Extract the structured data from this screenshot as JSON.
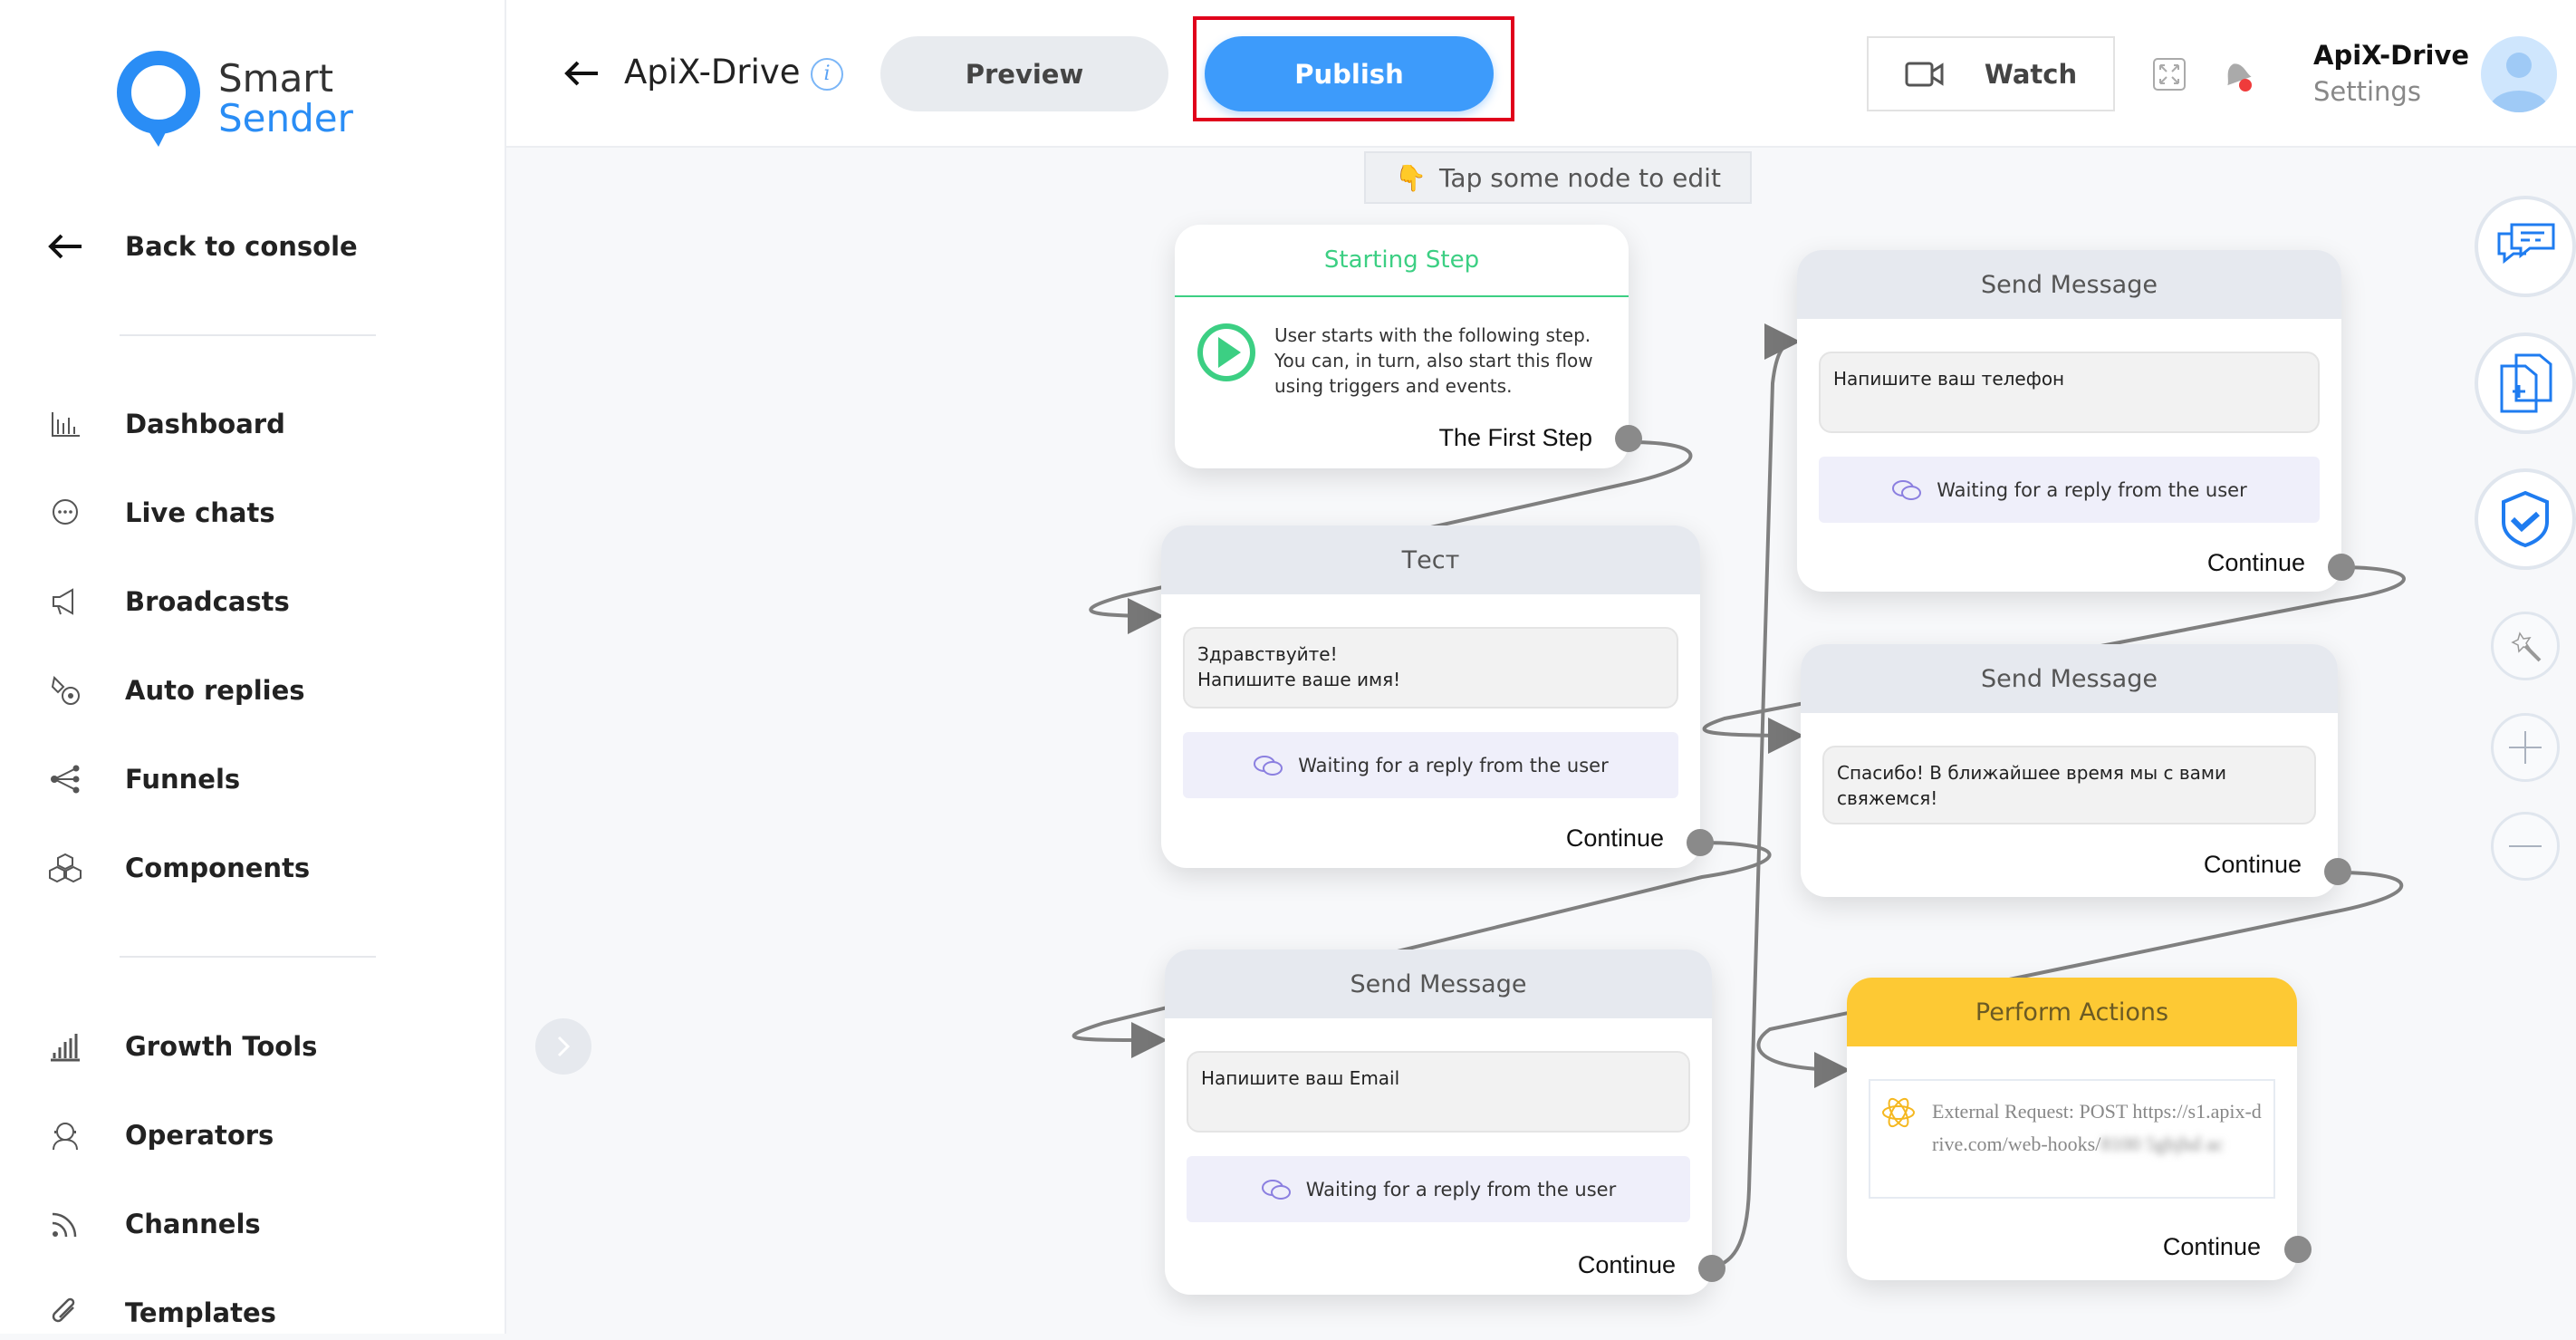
{
  "brand": {
    "name_line1": "Smart",
    "name_line2": "Sender",
    "accent": "#2a8df5"
  },
  "sidebar": {
    "back": "Back to console",
    "items": [
      {
        "label": "Dashboard",
        "icon": "bar-chart-icon"
      },
      {
        "label": "Live chats",
        "icon": "chat-bubble-icon"
      },
      {
        "label": "Broadcasts",
        "icon": "megaphone-icon"
      },
      {
        "label": "Auto replies",
        "icon": "auto-reply-icon"
      },
      {
        "label": "Funnels",
        "icon": "funnel-share-icon"
      },
      {
        "label": "Components",
        "icon": "cubes-icon"
      }
    ],
    "items2": [
      {
        "label": "Growth Tools",
        "icon": "growth-bars-icon"
      },
      {
        "label": "Operators",
        "icon": "headset-icon"
      },
      {
        "label": "Channels",
        "icon": "rss-icon"
      },
      {
        "label": "Templates",
        "icon": "paperclip-icon"
      }
    ]
  },
  "header": {
    "title": "ApiX-Drive",
    "preview": "Preview",
    "publish": "Publish",
    "watch": "Watch",
    "account_name": "ApiX-Drive",
    "account_sub": "Settings",
    "publish_color": "#3d9bfb",
    "highlight_color": "#e0001b"
  },
  "canvas": {
    "hint_emoji": "👇",
    "hint": "Tap some node to edit",
    "nodes": {
      "start": {
        "title": "Starting Step",
        "text": "User starts with the following step. You can, in turn, also start this flow using triggers and events.",
        "footer": "The First Step",
        "color": "#3ccf83"
      },
      "test": {
        "title": "Тест",
        "message_line1": "Здравствуйте!",
        "message_line2": "Напишите ваше имя!",
        "waiting": "Waiting for a reply from the user",
        "footer": "Continue"
      },
      "send_phone": {
        "title": "Send Message",
        "message": "Напишите ваш телефон",
        "waiting": "Waiting for a reply from the user",
        "footer": "Continue"
      },
      "send_thanks": {
        "title": "Send Message",
        "message": "Спасибо! В ближайшее время мы с вами свяжемся!",
        "footer": "Continue"
      },
      "send_email": {
        "title": "Send Message",
        "message": "Напишите ваш Email",
        "waiting": "Waiting for a reply from the user",
        "footer": "Continue"
      },
      "perform": {
        "title": "Perform Actions",
        "action_label": "External Request: POST",
        "action_url": "https://s1.apix-drive.com/web-hooks/",
        "footer": "Continue",
        "color": "#fdc934"
      }
    }
  }
}
